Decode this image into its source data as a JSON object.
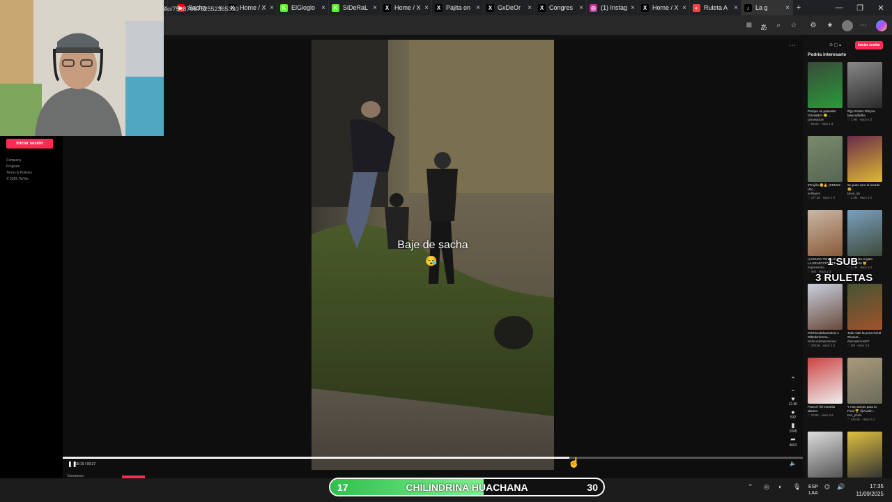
{
  "browser": {
    "tabs": [
      {
        "icon": "youtube-icon",
        "label": "Sacha",
        "color": "#ff0000",
        "glyph": "▶"
      },
      {
        "icon": "x-logo-icon",
        "label": "Home / X",
        "color": "#000000",
        "glyph": "X"
      },
      {
        "icon": "kick-icon",
        "label": "ElGloglo",
        "color": "#53fc18",
        "glyph": "K"
      },
      {
        "icon": "kick-icon",
        "label": "SiDeRaL",
        "color": "#53fc18",
        "glyph": "K"
      },
      {
        "icon": "x-logo-icon",
        "label": "Home / X",
        "color": "#000000",
        "glyph": "X"
      },
      {
        "icon": "x-logo-icon",
        "label": "Pajita on",
        "color": "#000000",
        "glyph": "X"
      },
      {
        "icon": "x-logo-icon",
        "label": "GxDeOr",
        "color": "#000000",
        "glyph": "X"
      },
      {
        "icon": "x-logo-icon",
        "label": "Congres",
        "color": "#000000",
        "glyph": "X"
      },
      {
        "icon": "instagram-icon",
        "label": "(1) Instag",
        "color": "#d6249f",
        "glyph": "◎"
      },
      {
        "icon": "x-logo-icon",
        "label": "Home / X",
        "color": "#000000",
        "glyph": "X"
      },
      {
        "icon": "roulette-icon",
        "label": "Ruleta A",
        "color": "#e44",
        "glyph": "◐"
      },
      {
        "icon": "tiktok-icon",
        "label": "La g",
        "color": "#000000",
        "glyph": "♪"
      }
    ],
    "url": "eo/7548796752552365330"
  },
  "tiktok": {
    "login_label": "Iniciar sesión",
    "footer_links": [
      "Company",
      "Program",
      "Terms & Policies",
      "© 2025 TikTok"
    ],
    "caption": "Baje de sacha",
    "caption_emoji": "😪",
    "time": "00:10 / 00:27",
    "progress": 0.685,
    "author": "Ilcreanovo",
    "stats": {
      "likes": "12.4K",
      "comments": "532",
      "saves": "1045",
      "shares": "4603"
    },
    "recommend_title": "Podría interesarte",
    "login_small": "Iniciar sesión",
    "recs": [
      {
        "title": "Porque no pateaste Grimaldo? 😂 ...",
        "user": "panwianpw",
        "stats": "♡ 56.5K · Hace 1 d"
      },
      {
        "title": "#fyp #sister #foryou laaxxxdbdba",
        "user": "",
        "stats": "♡ 3.9M · Hace 3 d"
      },
      {
        "title": "#Trujillo 🥺👍 ¡DEMLE UN...",
        "user": "sollepem",
        "stats": "♡ 277.5K · Hace 2 d"
      },
      {
        "title": "Se puso raro el arcade 😅...",
        "user": "bean_ob",
        "stats": "♡ 2.3M · Hace 3 d"
      },
      {
        "title": "¡LOCURA TOTAL EN LA SELECCIÓN DE...",
        "user": "impresentia",
        "stats": "♡ 46K · Hace 1 d"
      },
      {
        "title": "Encuentra al gato escondido 🐱",
        "user": "",
        "stats": "♡ 1.1M · Hace 3 d"
      },
      {
        "title": "#elchicodelasnoticia s #tiktokinforma...",
        "user": "elchicodelasnoticias",
        "stats": "♡ 260.5K · Hace 2 d"
      },
      {
        "title": "Todo vale la pena #viral #humor...",
        "user": "diamatemost97",
        "stats": "♡ 5M · Hace 3 d"
      },
      {
        "title": "Para el Titi mostrito abrazo",
        "user": "",
        "stats": "♡ 23.8K · Hace 3 d"
      },
      {
        "title": "Y nos vamos para la Final 🏆 @Austin...",
        "user": "bxs_pbillo",
        "stats": "♡ 242.4K · Hace 2 d"
      },
      {
        "title": "",
        "user": "",
        "stats": ""
      },
      {
        "title": "",
        "user": "",
        "stats": ""
      }
    ]
  },
  "stream_overlay": {
    "sub_text": "1 SUB",
    "ruletas_text": "3 RULETAS",
    "roulette": {
      "left": "17",
      "name": "CHILINDRINA HUACHANA",
      "right": "30",
      "fill": 0.56,
      "color": "#2fc04a"
    }
  },
  "taskbar": {
    "lang1": "ESP",
    "lang2": "LAA",
    "time": "17:35",
    "date": "11/09/2025"
  }
}
